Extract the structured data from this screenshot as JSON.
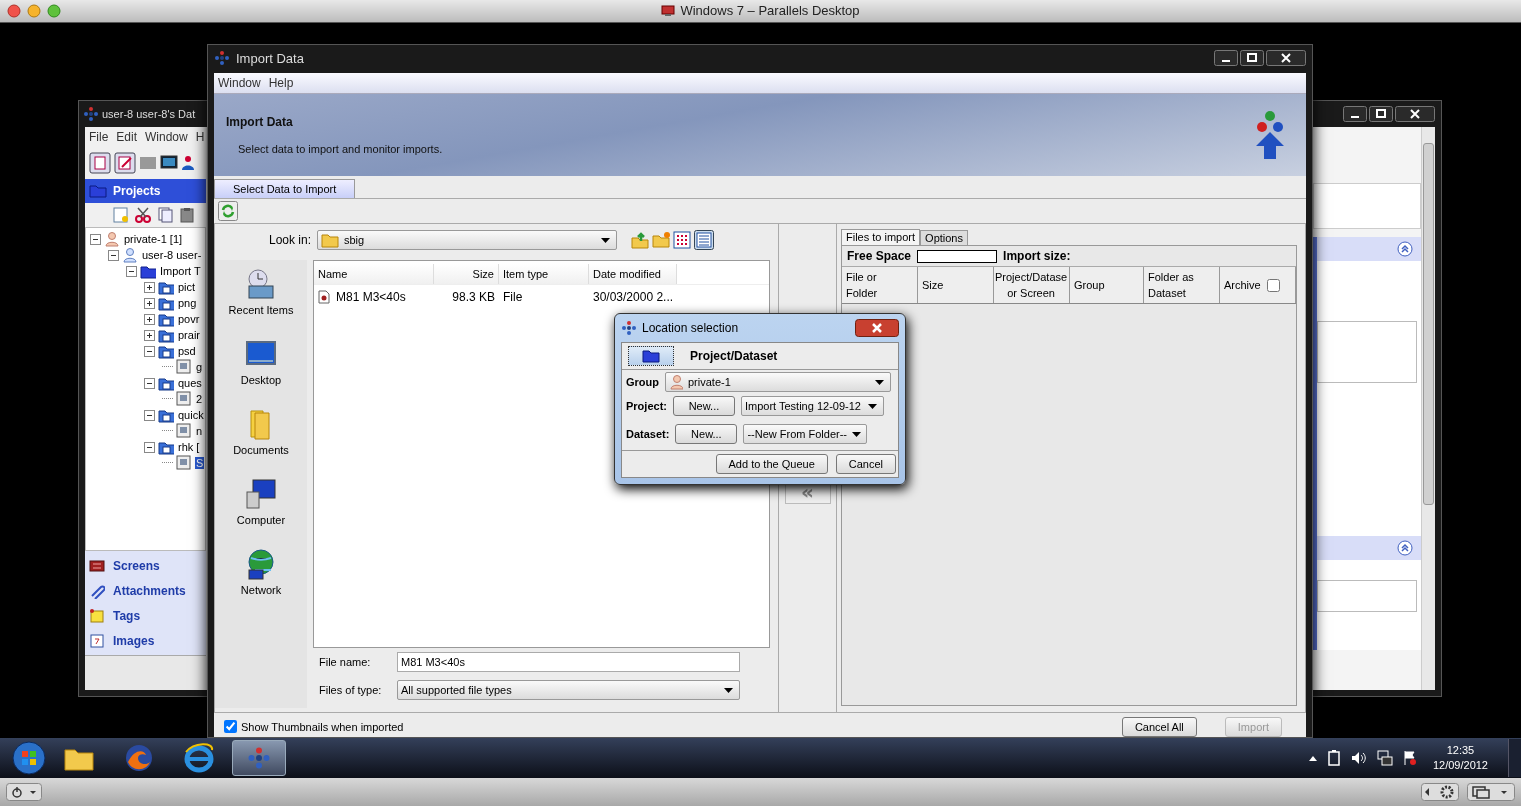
{
  "host": {
    "title": "Windows 7 – Parallels Desktop"
  },
  "back_window": {
    "title": "user-8 user-8's Dat",
    "menu": [
      "File",
      "Edit",
      "Window",
      "H"
    ],
    "panel_title": "Projects",
    "tree": [
      {
        "label": "private-1 [1]",
        "kind": "group",
        "expanded": true,
        "selected": false,
        "children": [
          {
            "label": "user-8 user-",
            "kind": "user",
            "expanded": true,
            "selected": false,
            "children": [
              {
                "label": "Import T",
                "kind": "project",
                "expanded": true,
                "selected": false,
                "children": [
                  {
                    "label": "pict",
                    "kind": "dataset",
                    "expanded": false,
                    "selected": false
                  },
                  {
                    "label": "png",
                    "kind": "dataset",
                    "expanded": false,
                    "selected": false
                  },
                  {
                    "label": "povr",
                    "kind": "dataset",
                    "expanded": false,
                    "selected": false
                  },
                  {
                    "label": "prair",
                    "kind": "dataset",
                    "expanded": false,
                    "selected": false
                  },
                  {
                    "label": "psd",
                    "kind": "dataset",
                    "expanded": true,
                    "selected": false,
                    "children": [
                      {
                        "label": "g",
                        "kind": "image",
                        "selected": false
                      }
                    ]
                  },
                  {
                    "label": "ques",
                    "kind": "dataset",
                    "expanded": true,
                    "selected": false,
                    "children": [
                      {
                        "label": "2",
                        "kind": "image",
                        "selected": false
                      }
                    ]
                  },
                  {
                    "label": "quick",
                    "kind": "dataset",
                    "expanded": true,
                    "selected": false,
                    "children": [
                      {
                        "label": "n",
                        "kind": "image",
                        "selected": false
                      }
                    ]
                  },
                  {
                    "label": "rhk [",
                    "kind": "dataset",
                    "expanded": true,
                    "selected": false,
                    "children": [
                      {
                        "label": "S",
                        "kind": "image",
                        "selected": true
                      }
                    ]
                  }
                ]
              }
            ]
          }
        ]
      }
    ],
    "sections": [
      {
        "label": "Screens",
        "kind": "screens"
      },
      {
        "label": "Attachments",
        "kind": "attachments"
      },
      {
        "label": "Tags",
        "kind": "tags"
      },
      {
        "label": "Images",
        "kind": "images"
      }
    ]
  },
  "import_window": {
    "title": "Import Data",
    "menu": [
      "Window",
      "Help"
    ],
    "header_title": "Import Data",
    "header_subtitle": "Select data to import and monitor imports.",
    "tabs": [
      {
        "label": "Select Data to Import",
        "selected": true
      }
    ],
    "chooser": {
      "look_in_label": "Look in:",
      "look_in": "sbig",
      "places": [
        {
          "label": "Recent Items",
          "kind": "recent"
        },
        {
          "label": "Desktop",
          "kind": "desktop"
        },
        {
          "label": "Documents",
          "kind": "documents"
        },
        {
          "label": "Computer",
          "kind": "computer"
        },
        {
          "label": "Network",
          "kind": "network"
        }
      ],
      "columns": [
        "Name",
        "Size",
        "Item type",
        "Date modified"
      ],
      "rows": [
        {
          "name": "M81 M3<40s",
          "size": "98.3 KB",
          "type": "File",
          "modified": "30/03/2000 2...",
          "selected": false
        }
      ],
      "file_name_label": "File name:",
      "file_name": "M81 M3<40s",
      "file_type_label": "Files of type:",
      "file_type": "All supported file types"
    },
    "move_button": "«",
    "queue": {
      "tabs": [
        {
          "label": "Files to import",
          "selected": true
        },
        {
          "label": "Options",
          "selected": false
        }
      ],
      "free_space_label": "Free Space",
      "free_space_bar": {
        "level": 0
      },
      "import_size_label": "Import size:",
      "columns": [
        "File or\nFolder",
        "Size",
        "Project/Datase\nor Screen",
        "Group",
        "Folder as\nDataset"
      ],
      "archive": {
        "label": "Archive",
        "checked": false
      }
    },
    "show_thumbnails": {
      "label": "Show Thumbnails when imported",
      "checked": true
    },
    "buttons": [
      {
        "label": "Cancel All",
        "disabled": false
      },
      {
        "label": "Import",
        "disabled": true
      }
    ]
  },
  "dialog": {
    "title": "Location selection",
    "heading": "Project/Dataset",
    "group_label": "Group",
    "group": "private-1",
    "project_label": "Project:",
    "project_new": "New...",
    "project": "Import Testing 12-09-12",
    "dataset_label": "Dataset:",
    "dataset_new": "New...",
    "dataset": "--New From Folder--",
    "buttons": [
      "Add to the Queue",
      "Cancel"
    ]
  },
  "taskbar": {
    "apps": [
      {
        "kind": "explorer",
        "selected": false
      },
      {
        "kind": "firefox",
        "selected": false
      },
      {
        "kind": "ie",
        "selected": false
      },
      {
        "kind": "omero",
        "selected": true
      }
    ],
    "time": "12:35",
    "date": "12/09/2012"
  }
}
